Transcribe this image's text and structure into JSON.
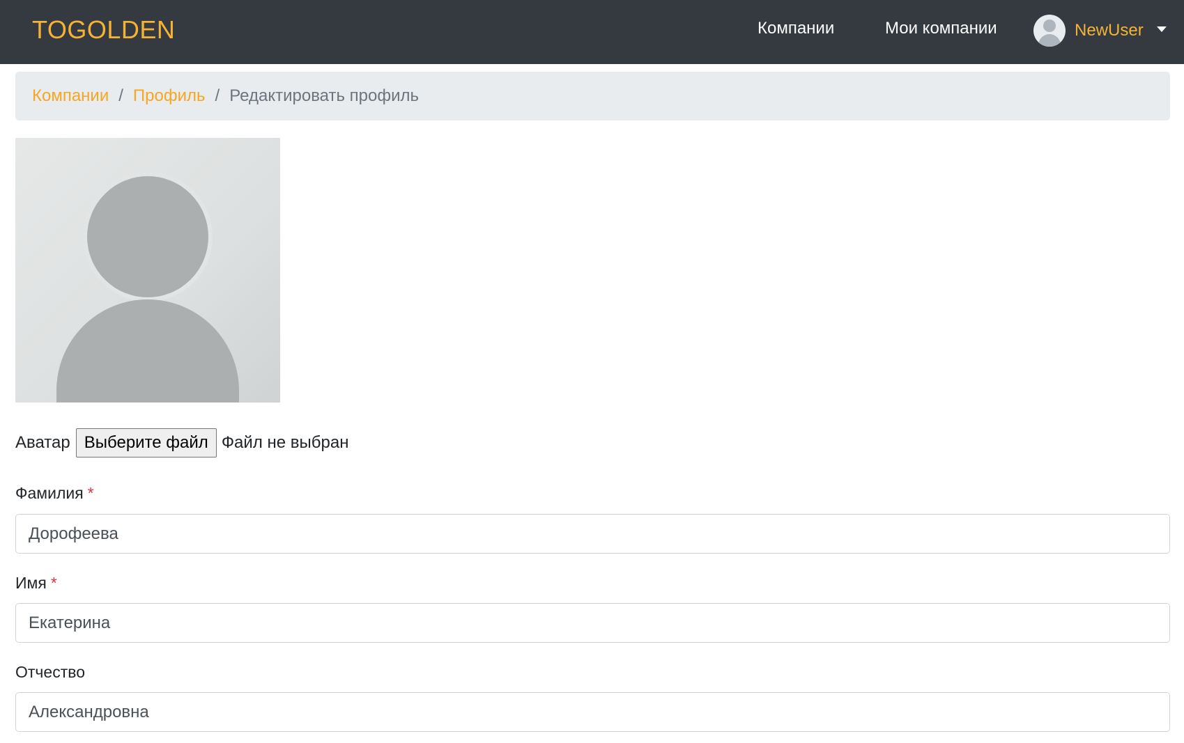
{
  "navbar": {
    "brand": "TOGOLDEN",
    "links": [
      {
        "label": "Компании"
      },
      {
        "label": "Мои компании"
      }
    ],
    "user": {
      "name": "NewUser",
      "avatar_icon": "user-silhouette-icon",
      "dropdown_icon": "caret-down-icon"
    }
  },
  "breadcrumb": {
    "items": [
      {
        "label": "Компании",
        "link": true
      },
      {
        "label": "Профиль",
        "link": true
      },
      {
        "label": "Редактировать профиль",
        "link": false
      }
    ],
    "separator": "/"
  },
  "avatar": {
    "icon": "user-silhouette-icon"
  },
  "file_input": {
    "label": "Аватар",
    "button_label": "Выберите файл",
    "status": "Файл не выбран"
  },
  "form": {
    "fields": [
      {
        "label": "Фамилия",
        "required_mark": "*",
        "value": "Дорофеева"
      },
      {
        "label": "Имя",
        "required_mark": "*",
        "value": "Екатерина"
      },
      {
        "label": "Отчество",
        "required_mark": "",
        "value": "Александровна"
      }
    ]
  },
  "colors": {
    "navbar_bg": "#343a40",
    "accent": "#f5b335",
    "breadcrumb_bg": "#e9ecef",
    "required": "#dc3545"
  }
}
